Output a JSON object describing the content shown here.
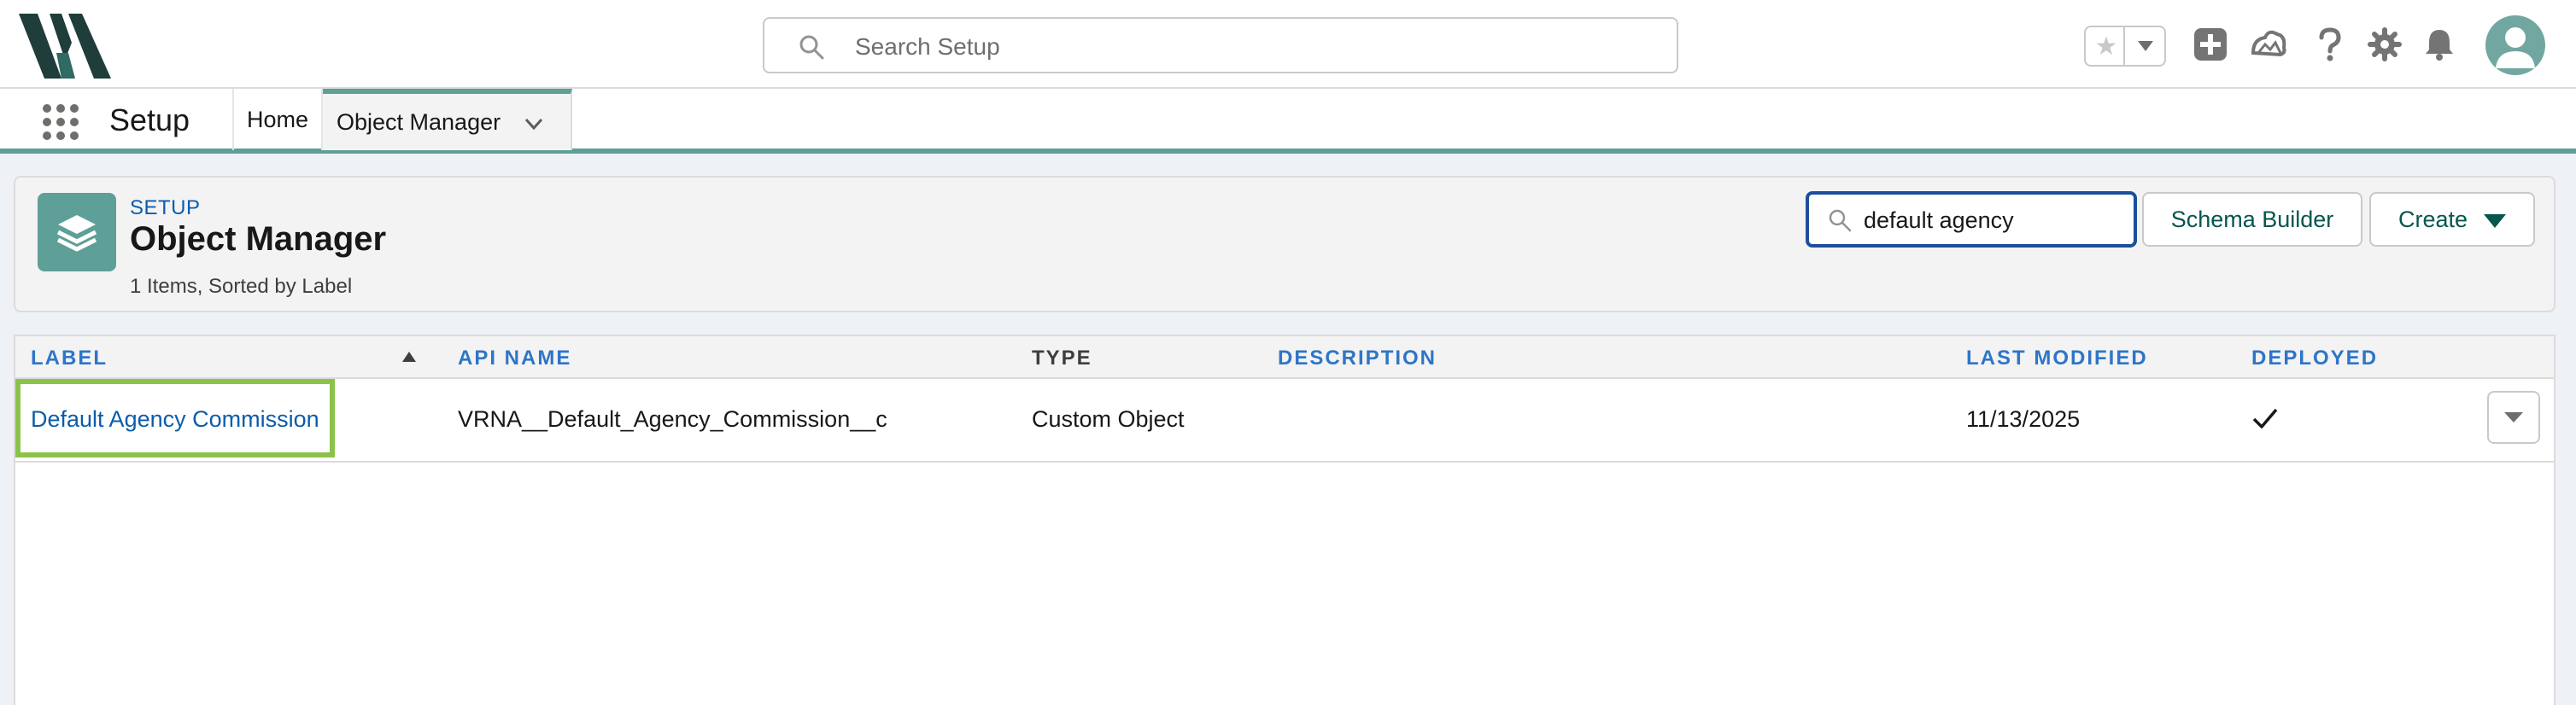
{
  "header": {
    "search_placeholder": "Search Setup",
    "colors": {
      "accent": "#5e9f97",
      "link": "#0b5cab",
      "highlight": "#8bc34a"
    }
  },
  "context_bar": {
    "app_name": "Setup",
    "tabs": [
      {
        "label": "Home"
      },
      {
        "label": "Object Manager"
      }
    ]
  },
  "page_header": {
    "breadcrumb": "SETUP",
    "title": "Object Manager",
    "meta": "1 Items, Sorted by Label",
    "quick_find_value": "default agency",
    "schema_builder_label": "Schema Builder",
    "create_label": "Create"
  },
  "table": {
    "columns": [
      "LABEL",
      "API NAME",
      "TYPE",
      "DESCRIPTION",
      "LAST MODIFIED",
      "DEPLOYED"
    ],
    "rows": [
      {
        "label": "Default Agency Commission",
        "api_name": "VRNA__Default_Agency_Commission__c",
        "type": "Custom Object",
        "description": "",
        "last_modified": "11/13/2025",
        "deployed": true
      }
    ]
  }
}
